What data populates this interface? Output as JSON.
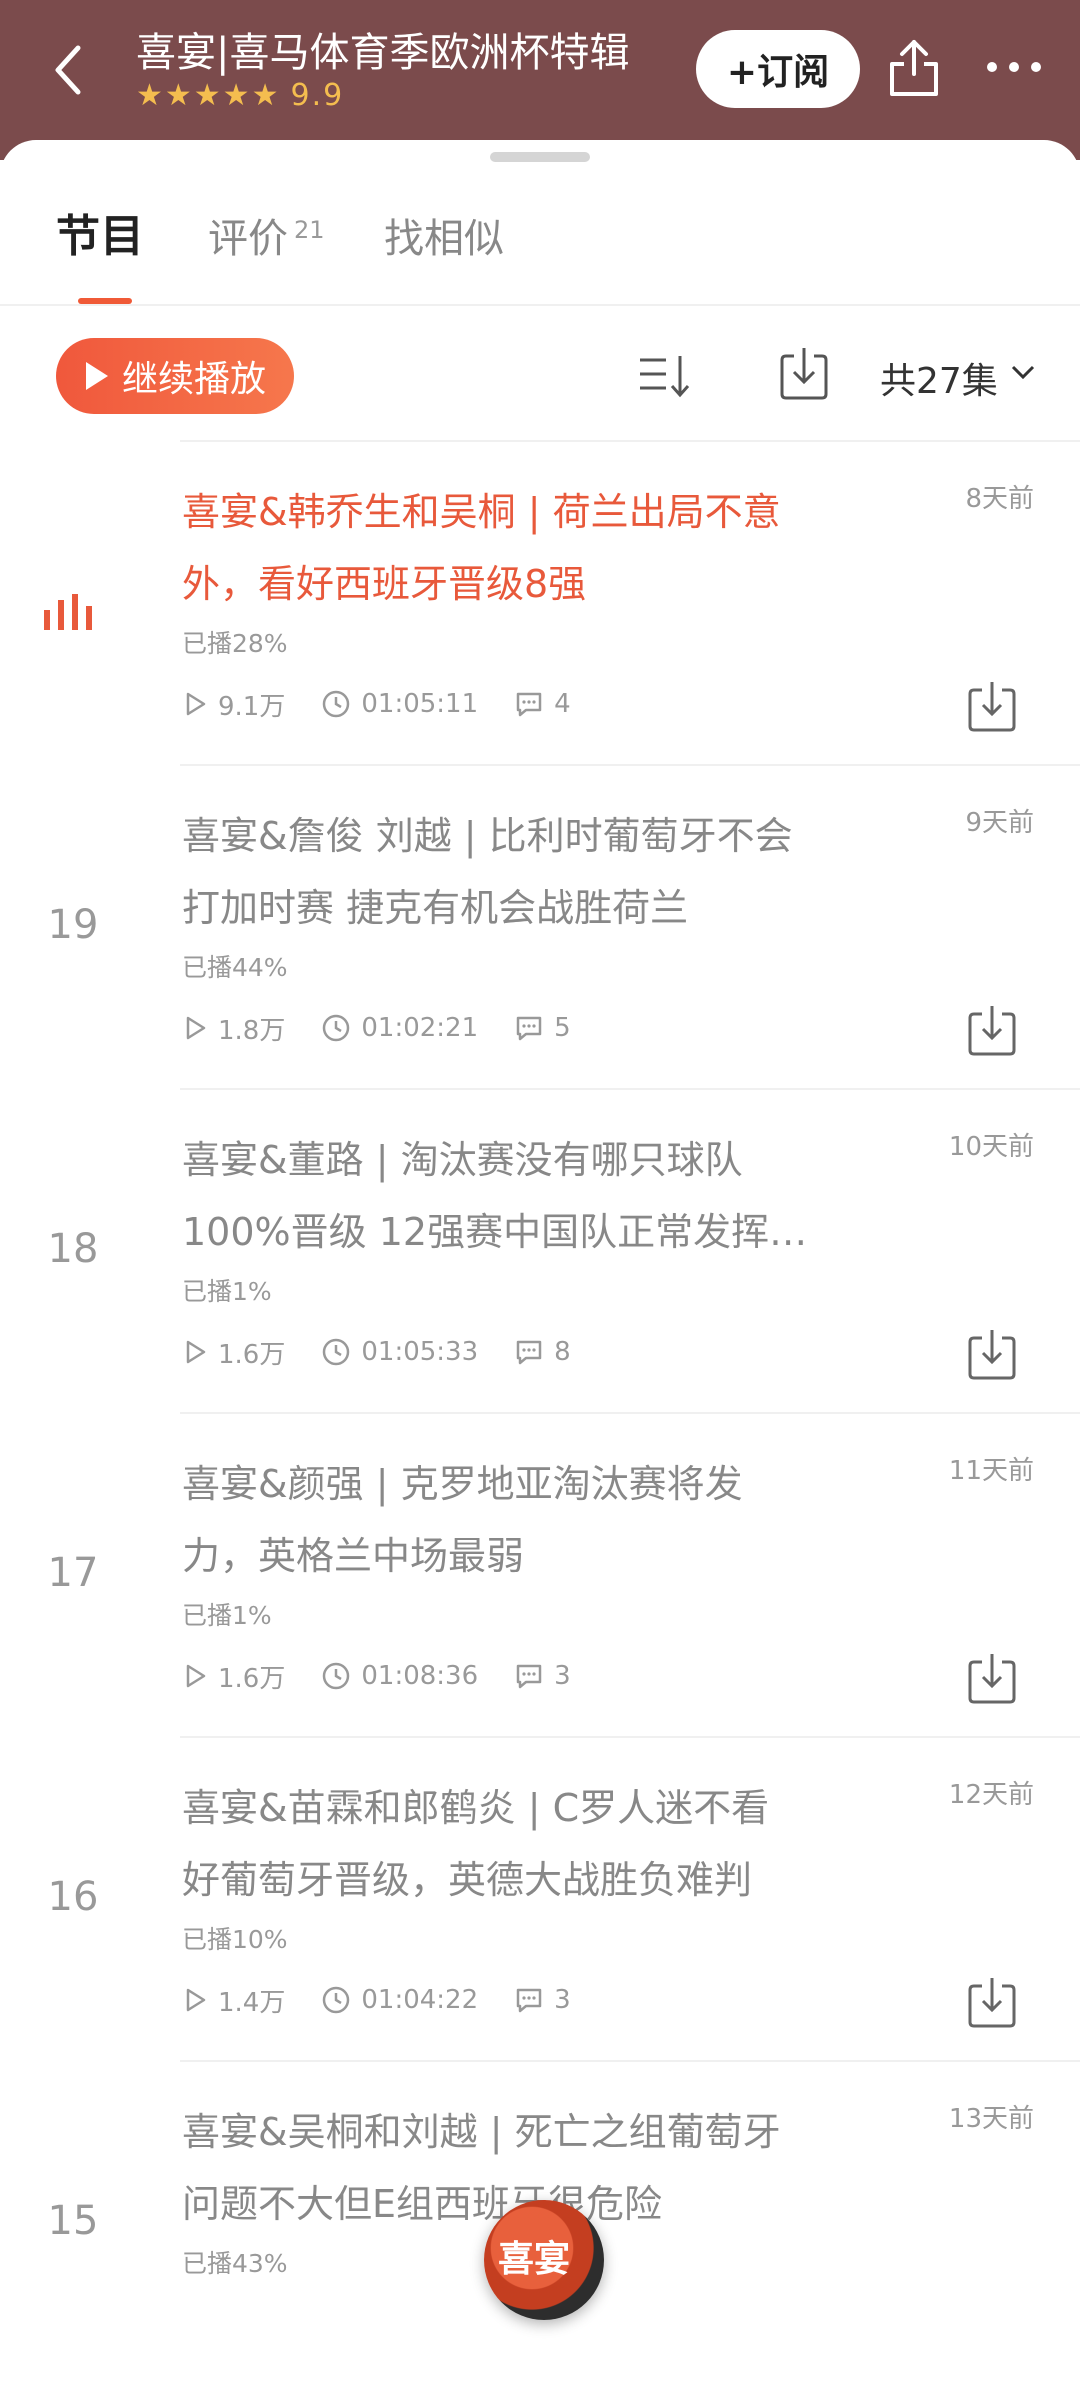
{
  "header": {
    "title": "喜宴|喜马体育季欧洲杯特辑",
    "stars": "★★★★★",
    "score": "9.9",
    "subscribe_label": "+订阅"
  },
  "tabs": [
    {
      "label": "节目"
    },
    {
      "label": "评价",
      "count": "21"
    },
    {
      "label": "找相似"
    }
  ],
  "toolbar": {
    "continue_label": "继续播放",
    "episode_count": "共27集"
  },
  "episodes": [
    {
      "number": "",
      "title_line1": "喜宴&韩乔生和吴桐 | 荷兰出局不意",
      "title_line2": "外，看好西班牙晋级8强",
      "date": "8天前",
      "progress": "已播28%",
      "plays": "9.1万",
      "duration": "01:05:11",
      "comments": "4",
      "playing": true
    },
    {
      "number": "19",
      "title_line1": "喜宴&詹俊 刘越 | 比利时葡萄牙不会",
      "title_line2": "打加时赛 捷克有机会战胜荷兰",
      "date": "9天前",
      "progress": "已播44%",
      "plays": "1.8万",
      "duration": "01:02:21",
      "comments": "5",
      "playing": false
    },
    {
      "number": "18",
      "title_line1": "喜宴&董路 | 淘汰赛没有哪只球队",
      "title_line2": "100%晋级 12强赛中国队正常发挥…",
      "date": "10天前",
      "progress": "已播1%",
      "plays": "1.6万",
      "duration": "01:05:33",
      "comments": "8",
      "playing": false
    },
    {
      "number": "17",
      "title_line1": "喜宴&颜强 | 克罗地亚淘汰赛将发",
      "title_line2": "力，英格兰中场最弱",
      "date": "11天前",
      "progress": "已播1%",
      "plays": "1.6万",
      "duration": "01:08:36",
      "comments": "3",
      "playing": false
    },
    {
      "number": "16",
      "title_line1": "喜宴&苗霖和郎鹤炎 | C罗人迷不看",
      "title_line2": "好葡萄牙晋级，英德大战胜负难判",
      "date": "12天前",
      "progress": "已播10%",
      "plays": "1.4万",
      "duration": "01:04:22",
      "comments": "3",
      "playing": false
    },
    {
      "number": "15",
      "title_line1": "喜宴&吴桐和刘越 | 死亡之组葡萄牙",
      "title_line2": "问题不大但E组西班牙很危险",
      "date": "13天前",
      "progress": "已播43%",
      "plays": "",
      "duration": "",
      "comments": "",
      "playing": false
    }
  ],
  "player": {
    "cover_text": "喜宴"
  },
  "colors": {
    "header_bg": "#7b4b4c",
    "accent": "#f05a37",
    "star": "#f4bd4f"
  }
}
